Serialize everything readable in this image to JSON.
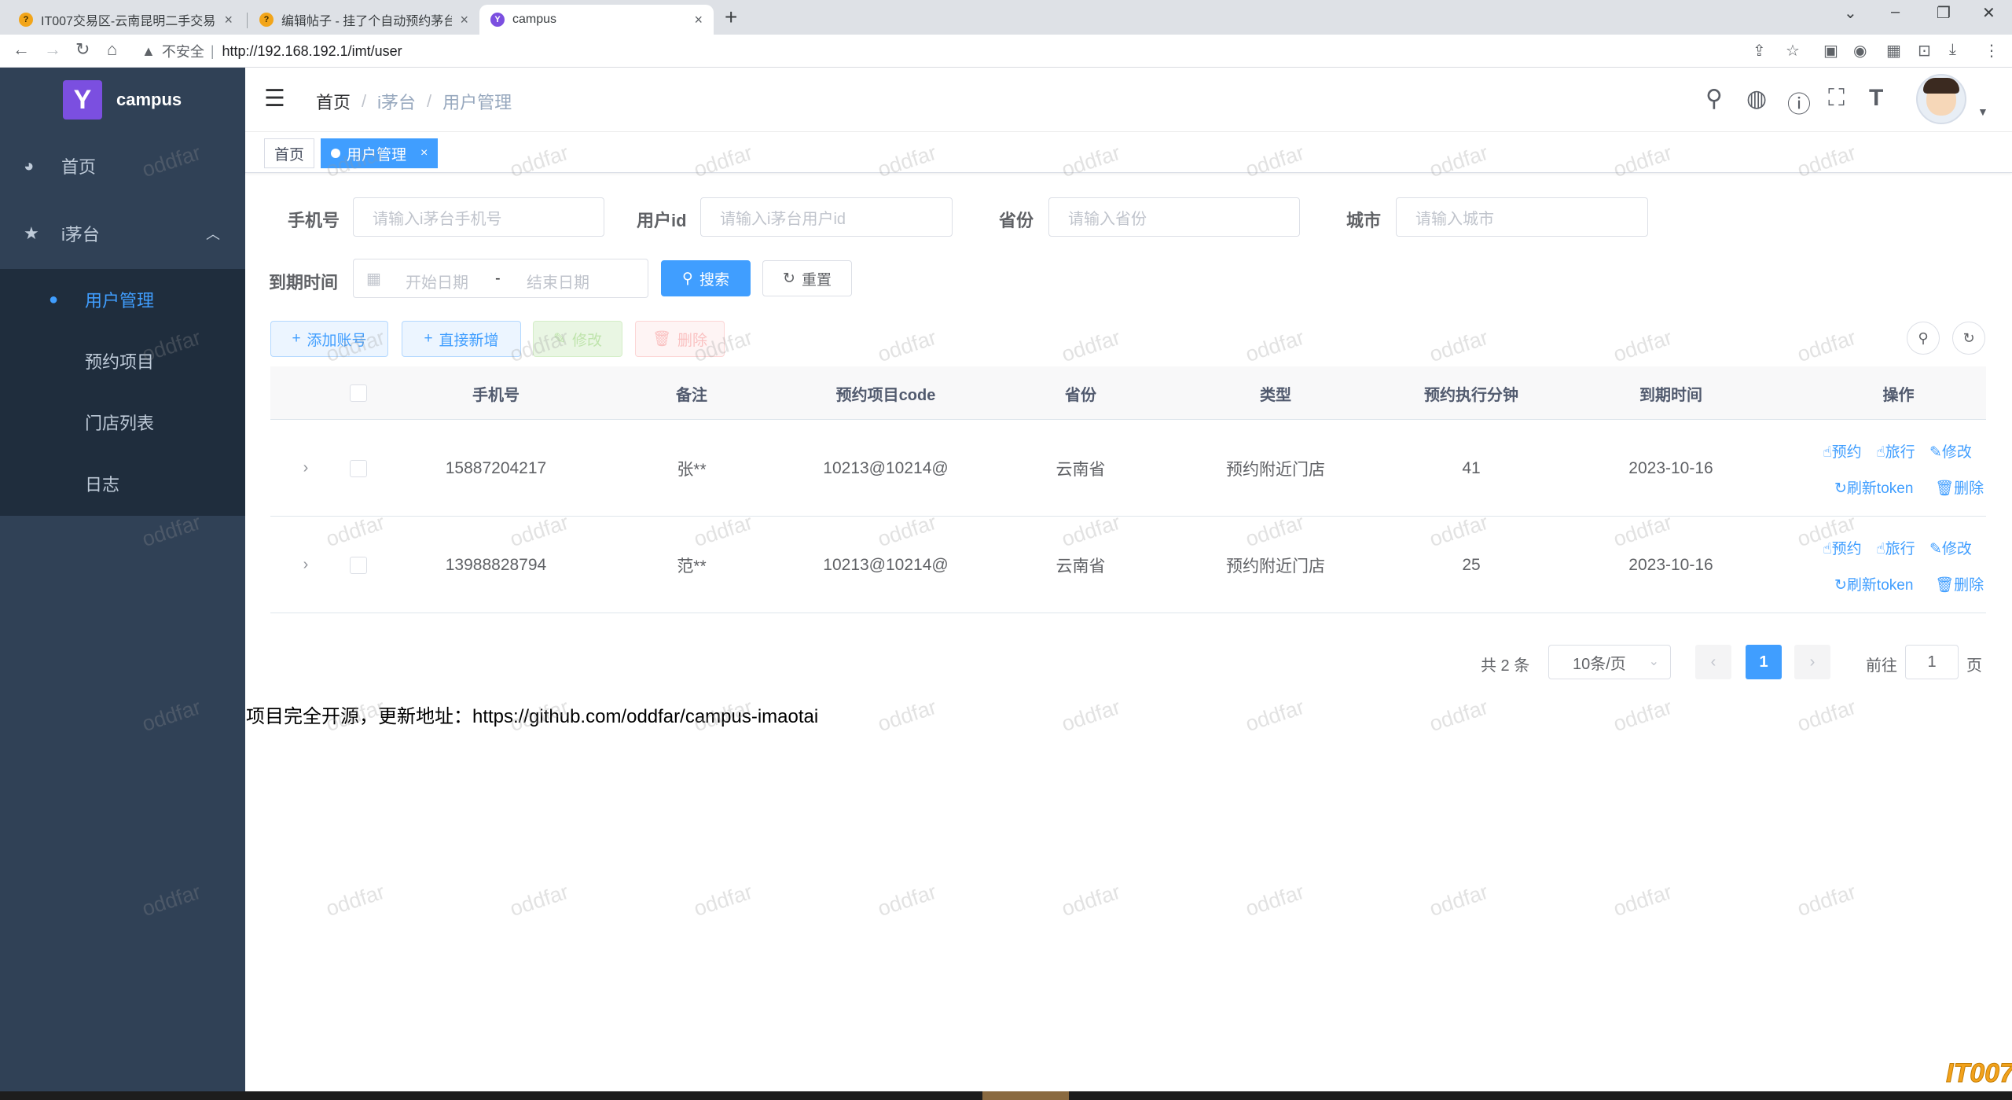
{
  "browser": {
    "tabs": [
      {
        "title": "IT007交易区-云南昆明二手交易",
        "favicon": "it007-favicon"
      },
      {
        "title": "编辑帖子 - 挂了个自动预约茅台",
        "favicon": "it007-favicon"
      },
      {
        "title": "campus",
        "favicon": "campus-favicon"
      }
    ],
    "insecure_label": "不安全",
    "url": "http://192.168.192.1/imt/user"
  },
  "sidebar": {
    "logo_text": "campus",
    "menu": [
      {
        "label": "首页",
        "icon": "dashboard-icon"
      },
      {
        "label": "i茅台",
        "icon": "star-icon"
      }
    ],
    "submenu": [
      {
        "label": "用户管理",
        "icon": "user-icon",
        "active": true
      },
      {
        "label": "预约项目"
      },
      {
        "label": "门店列表"
      },
      {
        "label": "日志"
      }
    ]
  },
  "navbar": {
    "breadcrumb": [
      "首页",
      "i茅台",
      "用户管理"
    ],
    "icons": [
      "search-icon",
      "github-icon",
      "question-icon",
      "fullscreen-icon",
      "font-size-icon"
    ]
  },
  "tags": [
    {
      "label": "首页",
      "active": false
    },
    {
      "label": "用户管理",
      "active": true,
      "close": "×"
    }
  ],
  "search": {
    "phone_label": "手机号",
    "phone_placeholder": "请输入i茅台手机号",
    "userid_label": "用户id",
    "userid_placeholder": "请输入i茅台用户id",
    "province_label": "省份",
    "province_placeholder": "请输入省份",
    "city_label": "城市",
    "city_placeholder": "请输入城市",
    "expire_label": "到期时间",
    "start_placeholder": "开始日期",
    "range_sep": "-",
    "end_placeholder": "结束日期",
    "search_button": "搜索",
    "reset_button": "重置"
  },
  "actions": {
    "add_account": "添加账号",
    "direct_add": "直接新增",
    "edit": "修改",
    "delete": "删除"
  },
  "table": {
    "columns": [
      "手机号",
      "备注",
      "预约项目code",
      "省份",
      "类型",
      "预约执行分钟",
      "到期时间",
      "操作"
    ],
    "rows": [
      {
        "phone": "15887204217",
        "remark": "张**",
        "code": "10213@10214@",
        "province": "云南省",
        "type": "预约附近门店",
        "minute": "41",
        "expire": "2023-10-16"
      },
      {
        "phone": "13988828794",
        "remark": "范**",
        "code": "10213@10214@",
        "province": "云南省",
        "type": "预约附近门店",
        "minute": "25",
        "expire": "2023-10-16"
      }
    ],
    "ops": {
      "reserve": "预约",
      "travel": "旅行",
      "edit": "修改",
      "refresh": "刷新token",
      "delete": "删除"
    }
  },
  "pagination": {
    "total": "共 2 条",
    "page_size": "10条/页",
    "current": "1",
    "goto_label": "前往",
    "goto_value": "1",
    "page_suffix": "页"
  },
  "footer_note": "项目完全开源，更新地址：https://github.com/oddfar/campus-imaotai",
  "watermark": "oddfar",
  "corner_logo": "IT007",
  "colors": {
    "primary": "#409eff",
    "sidebar_bg": "#304156",
    "submenu_bg": "#1f2d3d"
  }
}
